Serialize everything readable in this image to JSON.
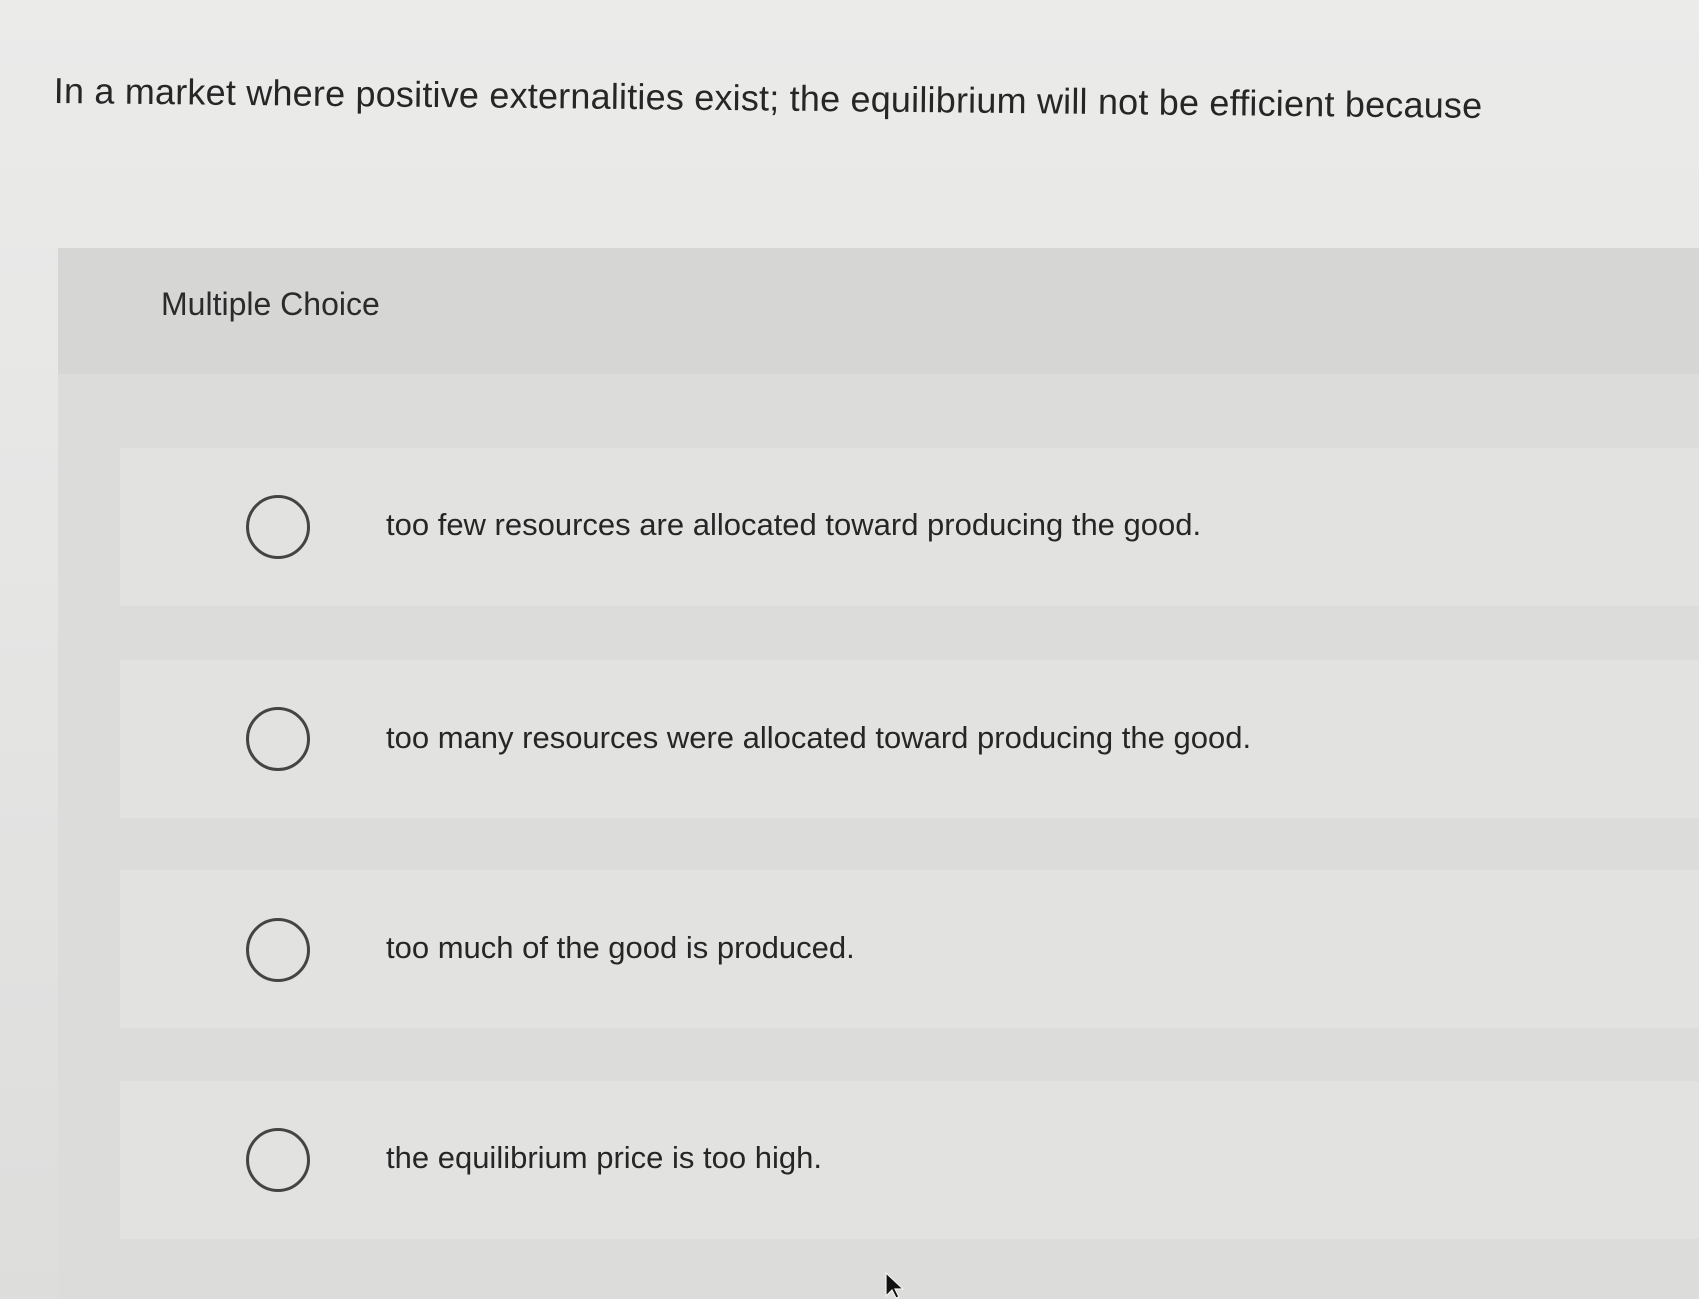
{
  "question": {
    "text": "In a market where positive externalities exist; the equilibrium will not be efficient because"
  },
  "multiple_choice": {
    "label": "Multiple Choice",
    "options": [
      {
        "text": "too few resources are allocated toward producing the good.",
        "selected": false
      },
      {
        "text": "too many resources were allocated toward producing the good.",
        "selected": false
      },
      {
        "text": "too much of the good is produced.",
        "selected": false
      },
      {
        "text": "the equilibrium price is too high.",
        "selected": false
      }
    ]
  },
  "icons": {
    "radio": "radio-circle-icon",
    "cursor": "mouse-pointer-icon"
  },
  "colors": {
    "background": "#e6e6e5",
    "panel": "#dcdcdb",
    "option_row": "#e2e2e1",
    "text": "#262626",
    "radio_border": "#444444"
  }
}
